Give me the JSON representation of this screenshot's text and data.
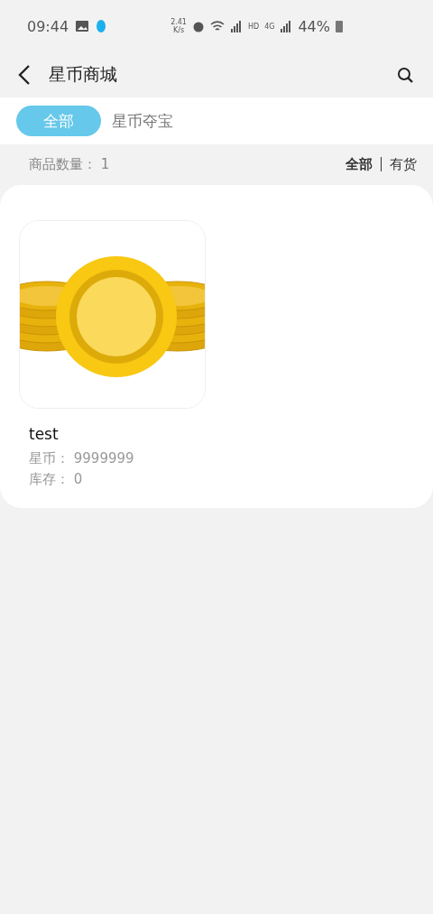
{
  "status_bar": {
    "time": "09:44",
    "speed": "2.41",
    "speed_unit": "K/s",
    "network": "4G",
    "hd": "HD",
    "battery": "44%"
  },
  "header": {
    "title": "星币商城"
  },
  "tabs": [
    {
      "label": "全部",
      "selected": true
    },
    {
      "label": "星币夺宝",
      "selected": false
    }
  ],
  "summary": {
    "label": "商品数量：",
    "count": "1"
  },
  "filters": [
    {
      "label": "全部",
      "selected": true
    },
    {
      "label": "有货",
      "selected": false
    }
  ],
  "products": [
    {
      "kind": "picture",
      "name": "test",
      "price_label": "星币：",
      "price": "9999999",
      "stock_label": "库存：",
      "stock": "0"
    }
  ]
}
